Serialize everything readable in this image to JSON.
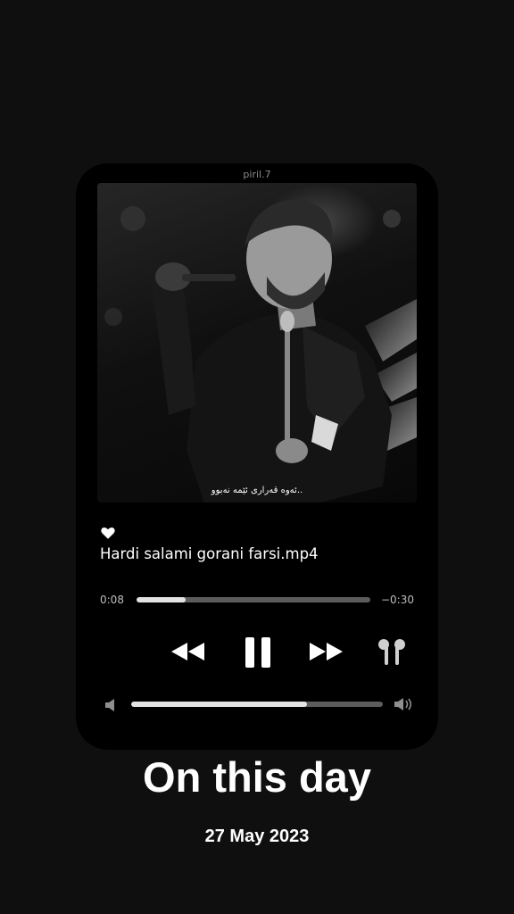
{
  "player": {
    "handle": "piril.7",
    "artwork": {
      "caption": "ئەوە قەرارى ئێمە نەبوو.."
    },
    "favorite_icon": "heart-icon",
    "track_title": "Hardi salami gorani farsi.mp4",
    "time_elapsed": "0:08",
    "time_remaining": "−0:30",
    "progress": 0.21,
    "controls": {
      "rewind_icon": "rewind-icon",
      "pause_icon": "pause-icon",
      "forward_icon": "fast-forward-icon",
      "output_icon": "airpods-icon"
    },
    "volume": {
      "low_icon": "speaker-low-icon",
      "high_icon": "speaker-high-icon",
      "level": 0.7
    }
  },
  "story": {
    "headline": "On this day",
    "date": "27 May 2023"
  },
  "colors": {
    "background": "#0f0f0f",
    "card": "#000000",
    "track_fill": "#e3e3e3",
    "track_base": "#5c5c5c"
  }
}
